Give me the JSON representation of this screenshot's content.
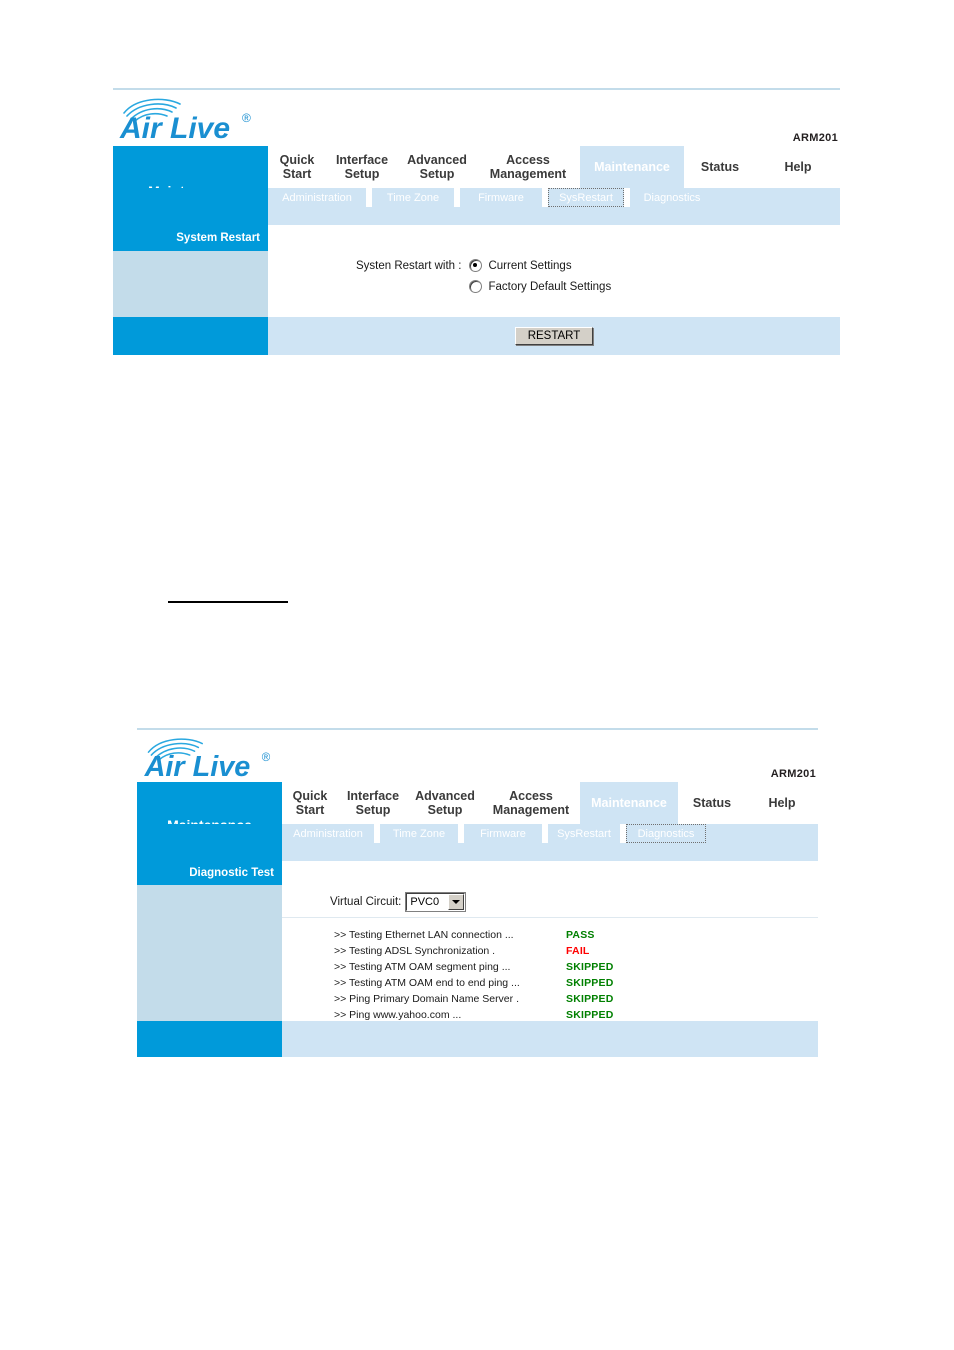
{
  "page": {
    "brand": "Air Live",
    "brand_trademark": "®",
    "model": "ARM201"
  },
  "nav": {
    "section_title": "Maintenance",
    "tabs": [
      {
        "label": "Quick\nStart",
        "active": false
      },
      {
        "label": "Interface\nSetup",
        "active": false
      },
      {
        "label": "Advanced\nSetup",
        "active": false
      },
      {
        "label": "Access\nManagement",
        "active": false
      },
      {
        "label": "Maintenance",
        "active": true
      },
      {
        "label": "Status",
        "active": false
      },
      {
        "label": "Help",
        "active": false
      }
    ],
    "subtabs": [
      {
        "label": "Administration"
      },
      {
        "label": "Time Zone"
      },
      {
        "label": "Firmware"
      },
      {
        "label": "SysRestart"
      },
      {
        "label": "Diagnostics"
      }
    ]
  },
  "panel1": {
    "group_label": "System Restart",
    "focused_subtab": "SysRestart",
    "field_label": "Systen Restart with :",
    "options": [
      {
        "label": "Current Settings",
        "checked": true
      },
      {
        "label": "Factory Default Settings",
        "checked": false
      }
    ],
    "restart_button": "RESTART"
  },
  "panel2": {
    "group_label": "Diagnostic Test",
    "focused_subtab": "Diagnostics",
    "virtual_circuit_label": "Virtual Circuit:",
    "virtual_circuit_value": "PVC0",
    "tests": [
      {
        "name": ">> Testing Ethernet LAN connection ...",
        "result": "PASS",
        "color": "#008000"
      },
      {
        "name": ">> Testing ADSL Synchronization .",
        "result": "FAIL",
        "color": "#ff0000"
      },
      {
        "name": ">> Testing ATM OAM segment ping ...",
        "result": "SKIPPED",
        "color": "#008000"
      },
      {
        "name": ">> Testing ATM OAM end to end ping ...",
        "result": "SKIPPED",
        "color": "#008000"
      },
      {
        "name": ">> Ping Primary Domain Name Server .",
        "result": "SKIPPED",
        "color": "#008000"
      },
      {
        "name": ">> Ping www.yahoo.com ...",
        "result": "SKIPPED",
        "color": "#008000"
      }
    ]
  },
  "colors": {
    "brand_blue": "#009ada",
    "tab_light": "#cfe4f4",
    "panel_fill": "#c3dcea",
    "rule": "#c3dcea"
  }
}
